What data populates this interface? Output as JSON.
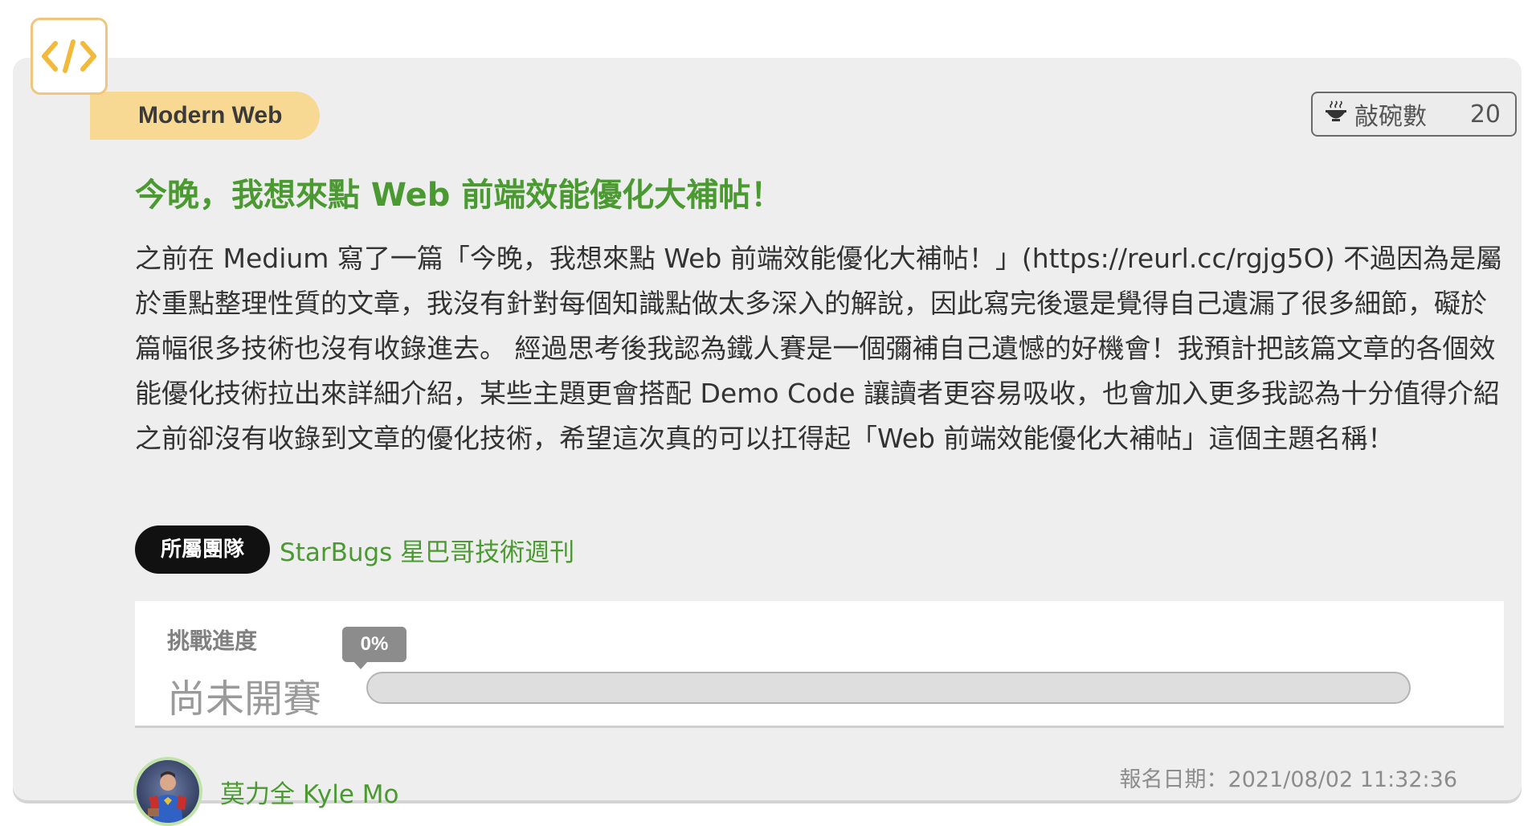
{
  "category": {
    "label": "Modern Web",
    "icon": "code-brackets-icon",
    "accent_color": "#f8d993"
  },
  "bowl": {
    "label": "敲碗數",
    "count": "20",
    "icon": "bowl-icon"
  },
  "title": "今晚，我想來點 Web 前端效能優化大補帖！",
  "description": "之前在 Medium 寫了一篇「今晚，我想來點 Web 前端效能優化大補帖！」(https://reurl.cc/rgjg5O) 不過因為是屬於重點整理性質的文章，我沒有針對每個知識點做太多深入的解說，因此寫完後還是覺得自己遺漏了很多細節，礙於篇幅很多技術也沒有收錄進去。 經過思考後我認為鐵人賽是一個彌補自己遺憾的好機會！我預計把該篇文章的各個效能優化技術拉出來詳細介紹，某些主題更會搭配 Demo Code 讓讀者更容易吸收，也會加入更多我認為十分值得介紹之前卻沒有收錄到文章的優化技術，希望這次真的可以扛得起「Web 前端效能優化大補帖」這個主題名稱！",
  "team": {
    "label": "所屬團隊",
    "name": "StarBugs 星巴哥技術週刊"
  },
  "progress": {
    "label": "挑戰進度",
    "status": "尚未開賽",
    "percent_text": "0%",
    "percent": 0
  },
  "author": {
    "name": "莫力全 Kyle Mo"
  },
  "registration": {
    "text": "報名日期：2021/08/02 11:32:36"
  },
  "colors": {
    "title_green": "#4a9a31",
    "card_bg": "#eeeeee"
  }
}
